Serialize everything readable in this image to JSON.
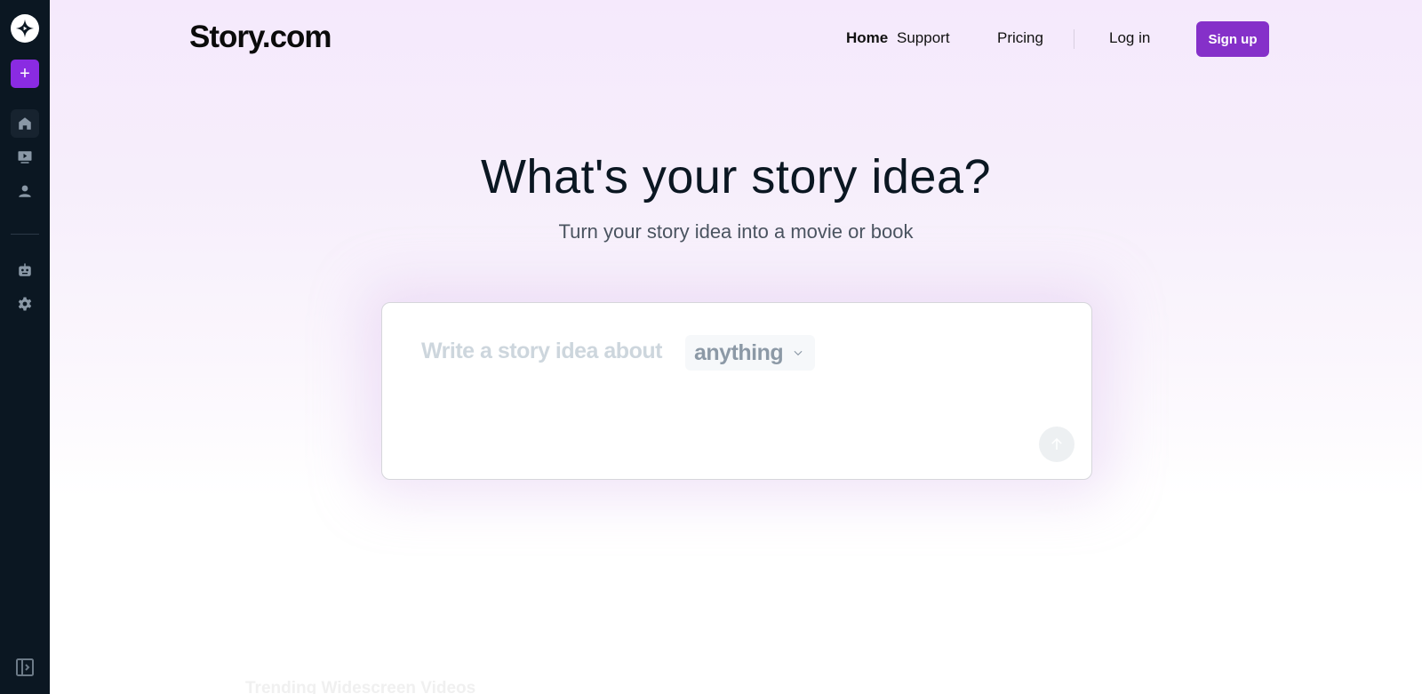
{
  "sidebar": {
    "logo_icon": "star-logo-icon",
    "new_button_label": "+",
    "items": [
      {
        "name": "home",
        "icon": "home-icon",
        "active": true
      },
      {
        "name": "videos",
        "icon": "video-icon",
        "active": false
      },
      {
        "name": "profile",
        "icon": "user-icon",
        "active": false
      },
      {
        "name": "bots",
        "icon": "robot-icon",
        "active": false
      },
      {
        "name": "settings",
        "icon": "gear-icon",
        "active": false
      }
    ],
    "expand_icon": "sidebar-expand-icon"
  },
  "header": {
    "brand": "Story.com",
    "nav": {
      "home": "Home",
      "support": "Support",
      "pricing": "Pricing",
      "login": "Log in",
      "signup": "Sign up"
    }
  },
  "hero": {
    "title": "What's your story idea?",
    "subtitle": "Turn your story idea into a movie or book"
  },
  "prompt": {
    "placeholder": "Write a story idea about",
    "topic_selected": "anything",
    "submit_icon": "arrow-up-icon"
  },
  "sections": {
    "trending_heading": "Trending Widescreen Videos"
  },
  "colors": {
    "accent": "#8530c9",
    "sidebar_bg": "#0b1722"
  }
}
